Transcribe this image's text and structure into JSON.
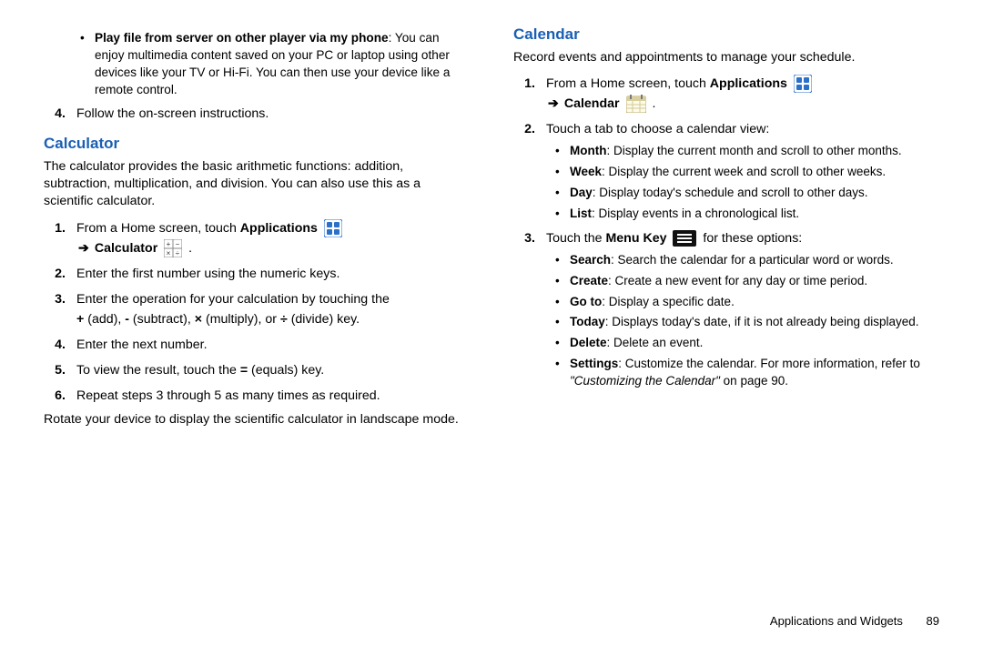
{
  "left": {
    "top_bullet_lead": "Play file from server on other player via my phone",
    "top_bullet_rest": ": You can enjoy multimedia content saved on your PC or laptop using other devices like your TV or Hi-Fi. You can then use your device like a remote control.",
    "step4": "Follow the on-screen instructions.",
    "calc_title": "Calculator",
    "calc_desc": "The calculator provides the basic arithmetic functions: addition, subtraction, multiplication, and division. You can also use this as a scientific calculator.",
    "calc_step1_a": "From a Home screen, touch ",
    "calc_step1_b": "Applications",
    "calc_step1_c": "Calculator",
    "calc_step2": "Enter the first number using the numeric keys.",
    "calc_step3_a": "Enter the operation for your calculation by touching the ",
    "calc_step3_b": " (add), ",
    "calc_step3_c": " (subtract), ",
    "calc_step3_d": " (multiply), or ",
    "calc_step3_e": " (divide) key.",
    "plus": "+",
    "minus": "-",
    "times": "×",
    "div": "÷",
    "calc_step4": "Enter the next number.",
    "calc_step5_a": "To view the result, touch the ",
    "equals": "=",
    "calc_step5_b": " (equals) key.",
    "calc_step6": "Repeat steps 3 through 5 as many times as required.",
    "calc_rotate": "Rotate your device to display the scientific calculator in landscape mode."
  },
  "right": {
    "cal_title": "Calendar",
    "cal_desc": "Record events and appointments to manage your schedule.",
    "cal_step1_a": "From a Home screen, touch ",
    "cal_step1_b": "Applications",
    "cal_step1_c": "Calendar",
    "cal_step2": "Touch a tab to choose a calendar view:",
    "views": [
      {
        "b": "Month",
        "t": ": Display the current month and scroll to other months."
      },
      {
        "b": "Week",
        "t": ": Display the current week and scroll to other weeks."
      },
      {
        "b": "Day",
        "t": ": Display today's schedule and scroll to other days."
      },
      {
        "b": "List",
        "t": ": Display events in a chronological list."
      }
    ],
    "cal_step3_a": "Touch the ",
    "cal_step3_b": "Menu Key",
    "cal_step3_c": " for these options:",
    "opts": [
      {
        "b": "Search",
        "t": ": Search the calendar for a particular word or words."
      },
      {
        "b": "Create",
        "t": ": Create a new event for any day or time period."
      },
      {
        "b": "Go to",
        "t": ": Display a specific date."
      },
      {
        "b": "Today",
        "t": ": Displays today's date, if it is not already being displayed."
      },
      {
        "b": "Delete",
        "t": ": Delete an event."
      }
    ],
    "settings_b": "Settings",
    "settings_t": ": Customize the calendar. For more information, refer to ",
    "settings_i": "\"Customizing the Calendar\"",
    "settings_p": "  on page 90."
  },
  "footer": {
    "section": "Applications and Widgets",
    "page": "89"
  },
  "markers": {
    "n1": "1.",
    "n2": "2.",
    "n3": "3.",
    "n4": "4.",
    "n5": "5.",
    "n6": "6."
  },
  "arrow": "➔",
  "period": "."
}
